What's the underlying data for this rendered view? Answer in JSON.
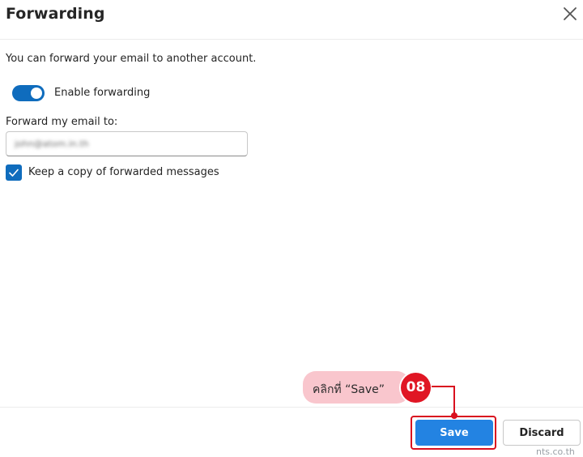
{
  "dialog": {
    "title": "Forwarding",
    "description": "You can forward your email to another account.",
    "toggle": {
      "label": "Enable forwarding",
      "on": true
    },
    "forward_field": {
      "label": "Forward my email to:",
      "value": "john@atom.in.th"
    },
    "keep_copy": {
      "label": "Keep a copy of forwarded messages",
      "checked": true
    },
    "buttons": {
      "save": "Save",
      "discard": "Discard"
    }
  },
  "annotation": {
    "callout_text": "คลิกที่ “Save”",
    "step_number": "08"
  },
  "watermark": "nts.co.th",
  "colors": {
    "accent": "#0f6cbd",
    "save_button": "#2383e2",
    "highlight_red": "#d9101f",
    "callout_pink": "#f9c6cd"
  }
}
